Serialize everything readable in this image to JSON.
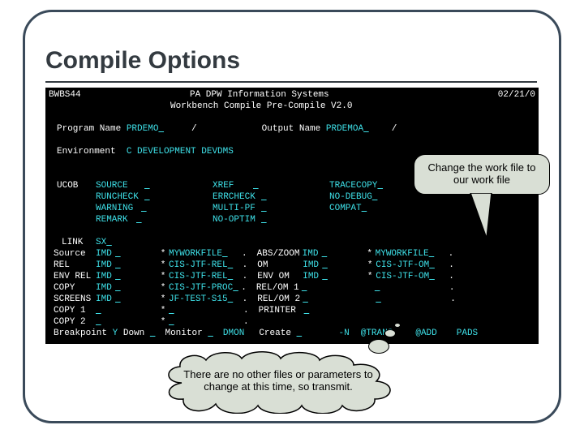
{
  "slide_title": "Compile Options",
  "callout1": "Change the work file to our work file",
  "callout2": "There are no other files or parameters to change at this time, so transmit.",
  "term": {
    "top_left": "BWBS44",
    "top_center1": "PA DPW Information Systems",
    "top_center2": "Workbench Compile Pre-Compile V2.0",
    "top_right": "02/21/0",
    "prog_label": "Program Name",
    "prog_name": "PRDEMO",
    "out_label": "Output Name",
    "out_name": "PRDEMOA",
    "env_label": "Environment",
    "env_val": "C DEVELOPMENT DEVDMS",
    "ucob": {
      "label": "UCOB",
      "col1": [
        "SOURCE",
        "RUNCHECK",
        "WARNING",
        "REMARK"
      ],
      "col2": [
        "XREF",
        "ERRCHECK",
        "MULTI-PF",
        "NO-OPTIM"
      ],
      "col3": [
        "TRACECOPY",
        "NO-DEBUG",
        "COMPAT"
      ]
    },
    "files": {
      "link_label": "LINK",
      "link_val": "SX",
      "rows_left": [
        "Source",
        "REL",
        "ENV REL",
        "COPY",
        "SCREENS",
        "COPY 1",
        "COPY 2"
      ],
      "rows_mid_val": [
        "IMD",
        "IMD",
        "IMD",
        "IMD",
        "IMD",
        "",
        ""
      ],
      "star_col": [
        "*",
        "*",
        "*",
        "*",
        "*",
        "*",
        "*"
      ],
      "col2_vals": [
        "MYWORKFILE",
        "CIS-JTF-REL",
        "CIS-JTF-REL",
        "CIS-JTF-PROC",
        "JF-TEST-S15",
        "",
        ""
      ],
      "abs_label": "ABS/ZOOM",
      "abs_rows": [
        "IMD",
        "IMD",
        "IMD"
      ],
      "col3_labels": [
        "",
        "OM",
        "ENV OM",
        "REL/OM 1",
        "REL/OM 2"
      ],
      "star_col3": [
        "*",
        "*",
        "*"
      ],
      "col3_vals": [
        "MYWORKFILE",
        "CIS-JTF-OM",
        "CIS-JTF-OM"
      ]
    },
    "footer": {
      "breakpoint_label": "Breakpoint",
      "breakpoint_val": "Y",
      "down_label": "Down",
      "monitor_label": "Monitor",
      "dmon": "DMON",
      "create_label": "Create",
      "printer_label": "PRINTER",
      "neg_n": "-N",
      "trans": "@TRANS",
      "add": "@ADD",
      "pads": "PADS"
    }
  }
}
